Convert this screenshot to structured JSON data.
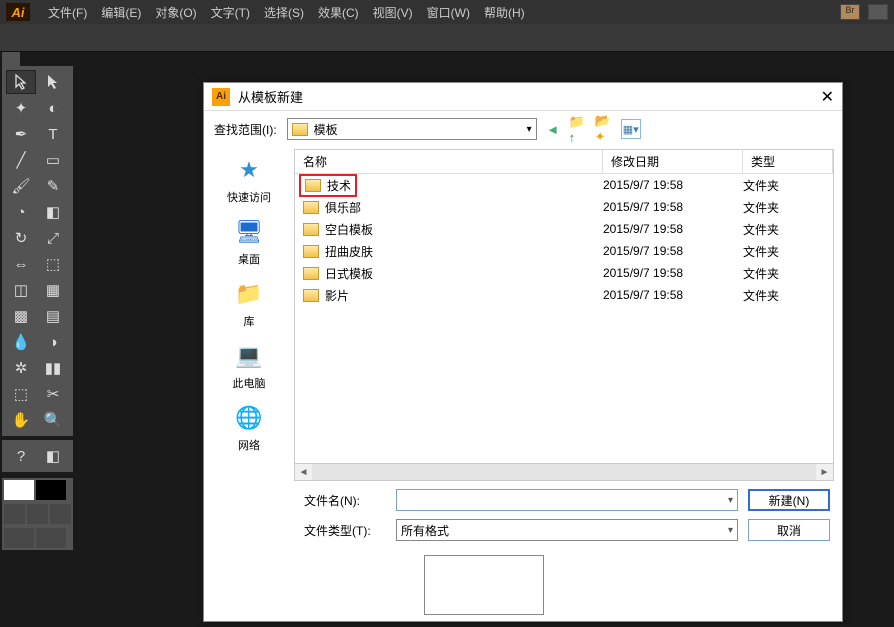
{
  "menubar": {
    "items": [
      "文件(F)",
      "编辑(E)",
      "对象(O)",
      "文字(T)",
      "选择(S)",
      "效果(C)",
      "视图(V)",
      "窗口(W)",
      "帮助(H)"
    ]
  },
  "dialog": {
    "title": "从模板新建",
    "scope_label": "查找范围(I):",
    "scope_value": "模板",
    "columns": {
      "name": "名称",
      "date": "修改日期",
      "type": "类型"
    },
    "rows": [
      {
        "name": "技术",
        "date": "2015/9/7 19:58",
        "type": "文件夹",
        "highlight": true
      },
      {
        "name": "俱乐部",
        "date": "2015/9/7 19:58",
        "type": "文件夹"
      },
      {
        "name": "空白模板",
        "date": "2015/9/7 19:58",
        "type": "文件夹"
      },
      {
        "name": "扭曲皮肤",
        "date": "2015/9/7 19:58",
        "type": "文件夹"
      },
      {
        "name": "日式模板",
        "date": "2015/9/7 19:58",
        "type": "文件夹"
      },
      {
        "name": "影片",
        "date": "2015/9/7 19:58",
        "type": "文件夹"
      }
    ],
    "places": [
      "快速访问",
      "桌面",
      "库",
      "此电脑",
      "网络"
    ],
    "filename_label": "文件名(N):",
    "filename_value": "",
    "filetype_label": "文件类型(T):",
    "filetype_value": "所有格式",
    "btn_new": "新建(N)",
    "btn_cancel": "取消"
  }
}
